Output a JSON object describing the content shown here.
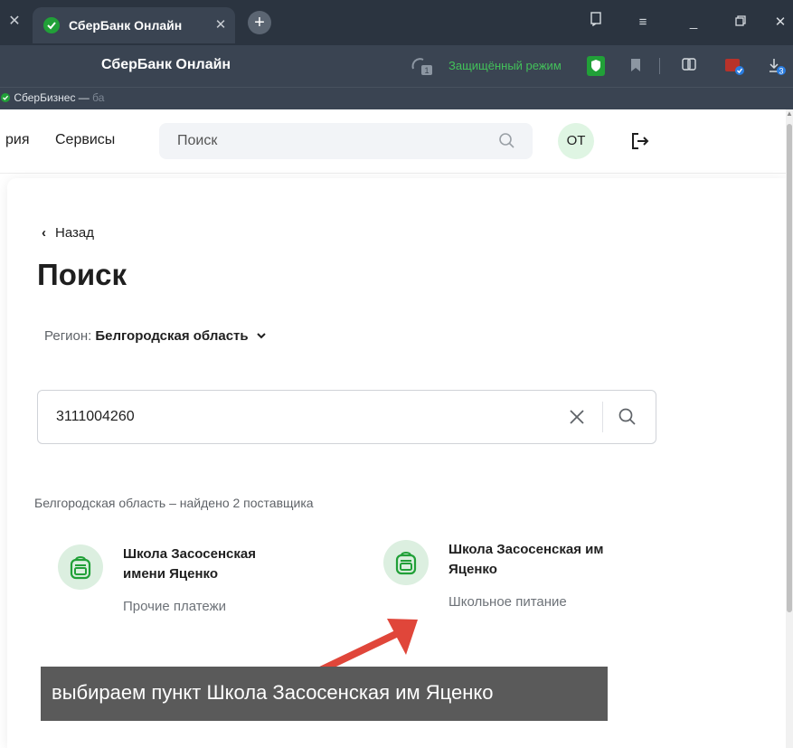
{
  "browser": {
    "tab_title": "СберБанк Онлайн",
    "window_title": "СберБанк Онлайн",
    "protected_mode": "Защищённый режим",
    "downloads_count": "3",
    "protect_badge": "1",
    "bookmark_text": "СберБизнес — ",
    "bookmark_fade": "ба"
  },
  "nav": {
    "items": [
      "рия",
      "Сервисы"
    ],
    "search_placeholder": "Поиск",
    "avatar_initials": "ОТ"
  },
  "main": {
    "back_label": "Назад",
    "title": "Поиск",
    "region_label": "Регион:",
    "region_value": "Белгородская область",
    "search_value": "3111004260",
    "results_summary": "Белгородская область – найдено 2 поставщика",
    "results": [
      {
        "name_line1": "Школа Засосенская",
        "name_line2": "имени Яценко",
        "category": "Прочие платежи"
      },
      {
        "name_line1": "Школа Засосенская им",
        "name_line2": "Яценко",
        "category": "Школьное питание"
      }
    ]
  },
  "annotation": {
    "caption": "выбираем пункт Школа Засосенская им Яценко",
    "arrow_color": "#e0463a"
  },
  "colors": {
    "brand": "#21a038",
    "tabbar": "#2b3440",
    "toolbar": "#3a4452"
  }
}
